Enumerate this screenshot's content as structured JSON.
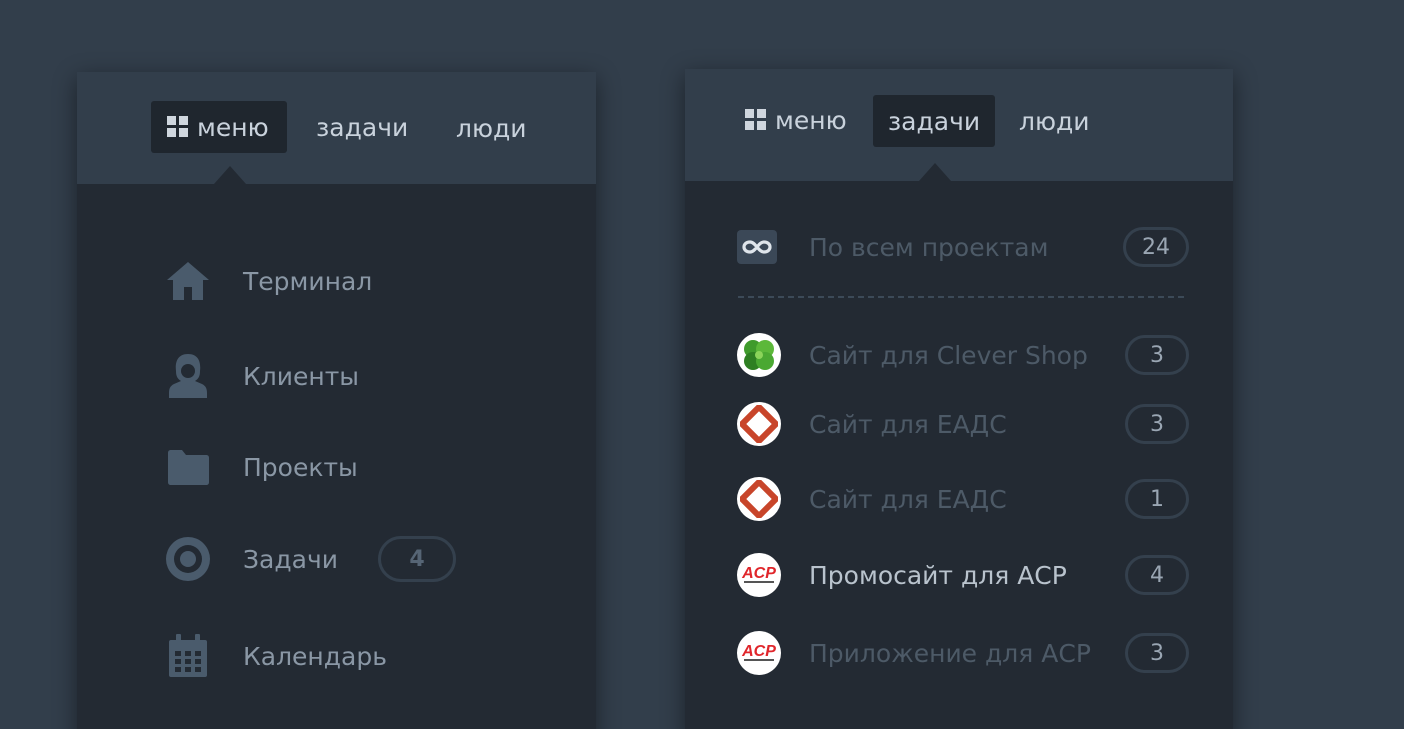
{
  "left_panel": {
    "tabs": [
      {
        "label": "меню",
        "active": true
      },
      {
        "label": "задачи",
        "active": false
      },
      {
        "label": "люди",
        "active": false
      }
    ],
    "items": [
      {
        "label": "Терминал",
        "icon": "home-icon"
      },
      {
        "label": "Клиенты",
        "icon": "user-icon"
      },
      {
        "label": "Проекты",
        "icon": "folder-icon"
      },
      {
        "label": "Задачи",
        "icon": "target-icon",
        "badge": "4"
      },
      {
        "label": "Календарь",
        "icon": "calendar-icon"
      }
    ]
  },
  "right_panel": {
    "tabs": [
      {
        "label": "меню",
        "active": false
      },
      {
        "label": "задачи",
        "active": true
      },
      {
        "label": "люди",
        "active": false
      }
    ],
    "all_projects": {
      "label": "По всем проектам",
      "count": "24",
      "icon": "infinity-icon"
    },
    "projects": [
      {
        "label": "Сайт для Clever Shop",
        "count": "3",
        "logo": "clover-logo",
        "highlight": false
      },
      {
        "label": "Сайт для ЕАДС",
        "count": "3",
        "logo": "eads-logo",
        "highlight": false
      },
      {
        "label": "Сайт для ЕАДС",
        "count": "1",
        "logo": "eads-logo",
        "highlight": false
      },
      {
        "label": "Промосайт для АСР",
        "count": "4",
        "logo": "acp-logo",
        "highlight": true
      },
      {
        "label": "Приложение для АСР",
        "count": "3",
        "logo": "acp-logo",
        "highlight": false
      }
    ]
  },
  "colors": {
    "background": "#323e4b",
    "panel": "#232a33",
    "header": "#323e4b",
    "active_tab": "#1f262e",
    "icon": "#4a5b6c",
    "acp_red": "#e0262b"
  }
}
